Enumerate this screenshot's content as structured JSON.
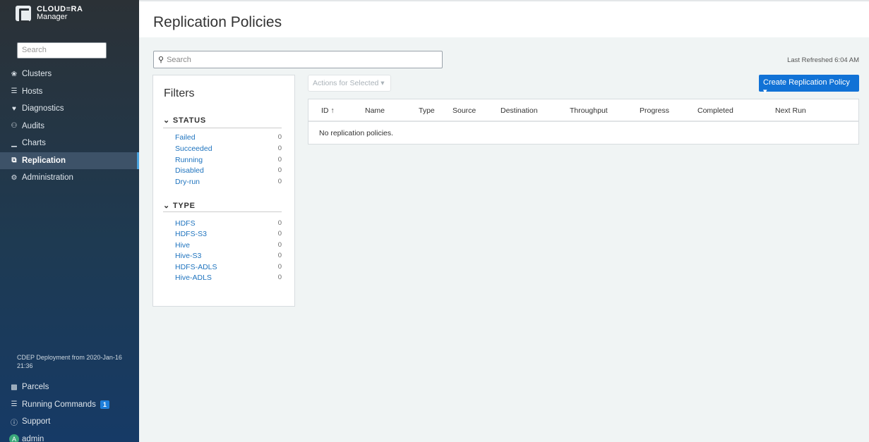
{
  "brand": {
    "name": "CLOUD≡RA",
    "product": "Manager"
  },
  "sidebar": {
    "search_placeholder": "Search",
    "items": [
      {
        "label": "Clusters",
        "icon": "clusters-icon",
        "glyph": "❀"
      },
      {
        "label": "Hosts",
        "icon": "hosts-icon",
        "glyph": "☰"
      },
      {
        "label": "Diagnostics",
        "icon": "diagnostics-icon",
        "glyph": "♥"
      },
      {
        "label": "Audits",
        "icon": "audits-icon",
        "glyph": "⚇"
      },
      {
        "label": "Charts",
        "icon": "charts-icon",
        "glyph": "▁"
      },
      {
        "label": "Replication",
        "icon": "replication-icon",
        "glyph": "⧉",
        "active": true
      },
      {
        "label": "Administration",
        "icon": "administration-icon",
        "glyph": "⚙"
      }
    ],
    "deployment": "CDEP Deployment from 2020-Jan-16 21:36",
    "bottom": {
      "parcels": "Parcels",
      "running_commands": "Running Commands",
      "running_count": "1",
      "support": "Support",
      "user": "admin",
      "user_initial": "A"
    }
  },
  "header": {
    "title": "Replication Policies"
  },
  "search": {
    "placeholder": "Search"
  },
  "last_refreshed": "Last Refreshed 6:04 AM",
  "filters": {
    "title": "Filters",
    "status": {
      "title": "STATUS",
      "items": [
        {
          "label": "Failed",
          "count": "0"
        },
        {
          "label": "Succeeded",
          "count": "0"
        },
        {
          "label": "Running",
          "count": "0"
        },
        {
          "label": "Disabled",
          "count": "0"
        },
        {
          "label": "Dry-run",
          "count": "0"
        }
      ]
    },
    "type": {
      "title": "TYPE",
      "items": [
        {
          "label": "HDFS",
          "count": "0"
        },
        {
          "label": "HDFS-S3",
          "count": "0"
        },
        {
          "label": "Hive",
          "count": "0"
        },
        {
          "label": "Hive-S3",
          "count": "0"
        },
        {
          "label": "HDFS-ADLS",
          "count": "0"
        },
        {
          "label": "Hive-ADLS",
          "count": "0"
        }
      ]
    }
  },
  "actions_label": "Actions for Selected ▾",
  "create_label": "Create Replication Policy ▾",
  "table": {
    "columns": [
      "ID ↑",
      "Name",
      "Type",
      "Source",
      "Destination",
      "Throughput",
      "Progress",
      "Completed",
      "Next Run"
    ],
    "empty": "No replication policies."
  },
  "colors": {
    "accent": "#1172d6",
    "link": "#1e73be",
    "sidebar_active": "#3d5268"
  }
}
